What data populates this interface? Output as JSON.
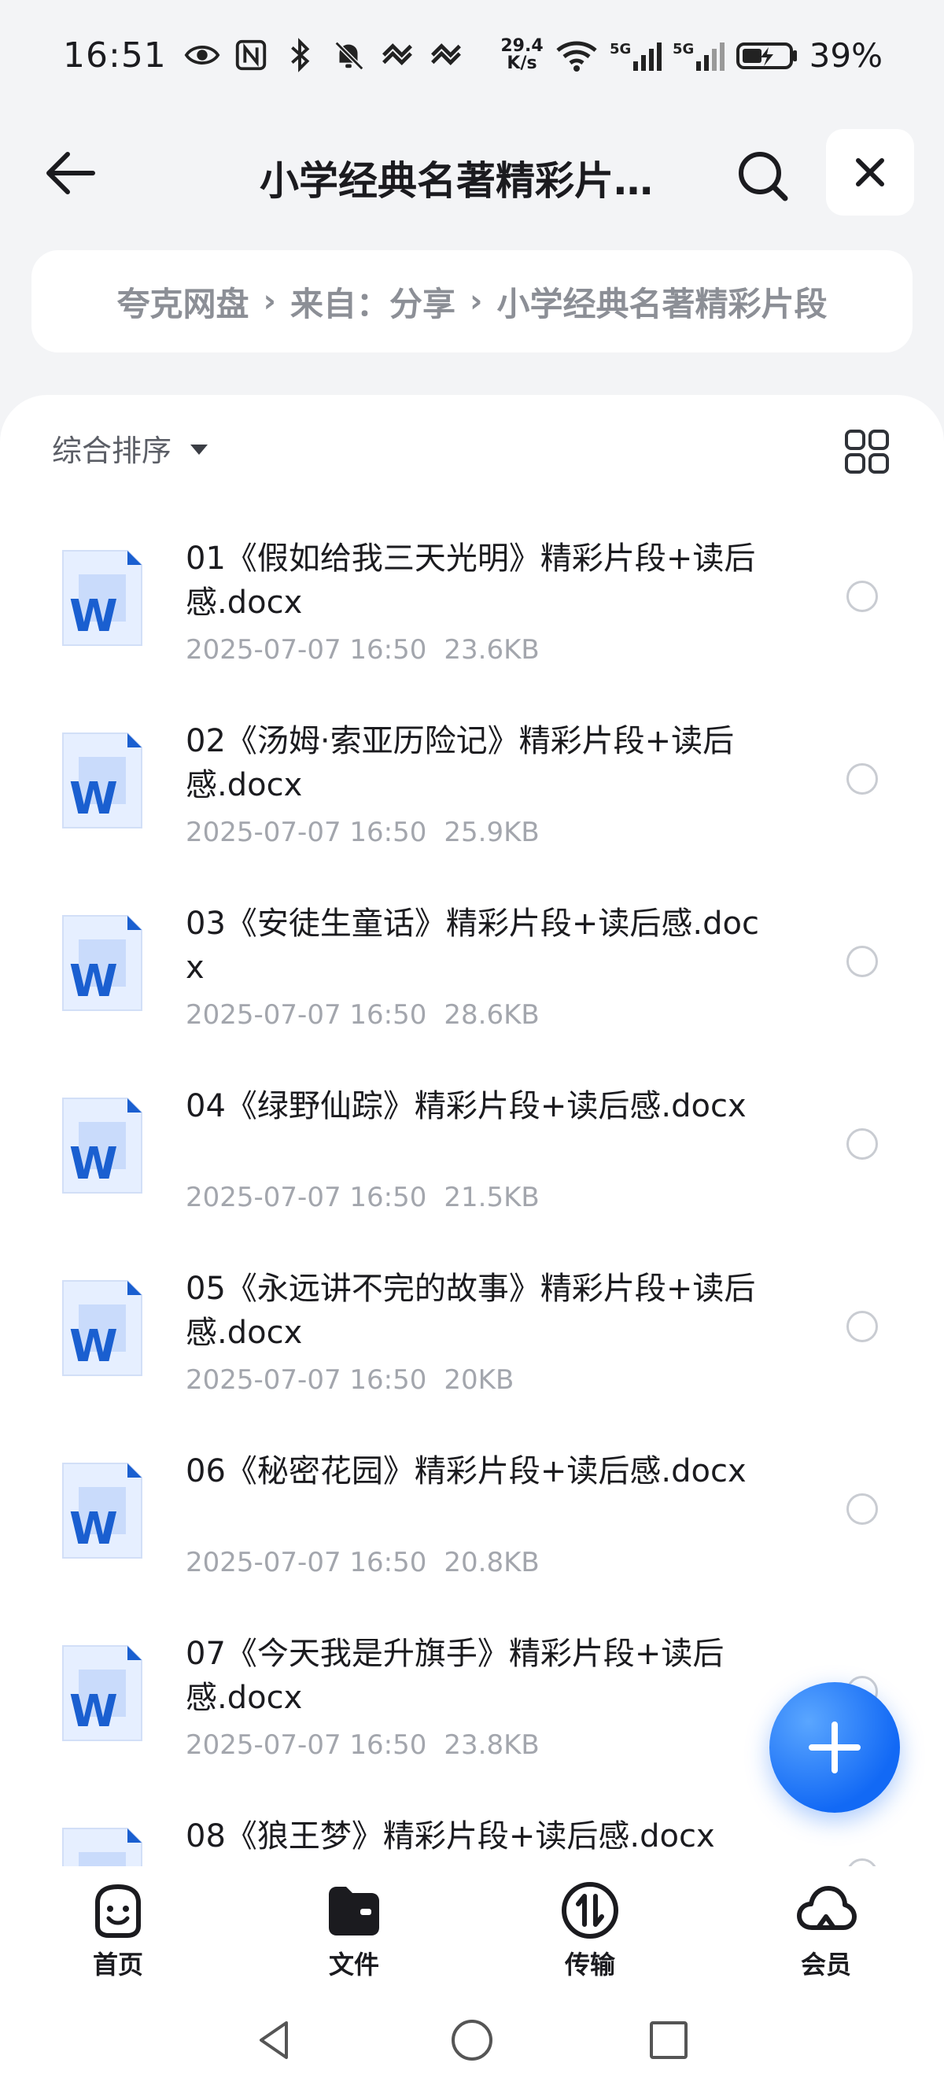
{
  "status_bar": {
    "time": "16:51",
    "net_speed_value": "29.4",
    "net_speed_unit": "K/s",
    "signal1_label": "5G",
    "signal2_label": "5G",
    "battery": "39%"
  },
  "header": {
    "title": "小学经典名著精彩片…"
  },
  "breadcrumb": {
    "items": [
      "夸克网盘",
      "来自：分享",
      "小学经典名著精彩片段"
    ]
  },
  "toolbar": {
    "sort_label": "综合排序"
  },
  "files": [
    {
      "name": "01《假如给我三天光明》精彩片段+读后感.docx",
      "date": "2025-07-07 16:50",
      "size": "23.6KB"
    },
    {
      "name": "02《汤姆·索亚历险记》精彩片段+读后感.docx",
      "date": "2025-07-07 16:50",
      "size": "25.9KB"
    },
    {
      "name": "03《安徒生童话》精彩片段+读后感.docx",
      "date": "2025-07-07 16:50",
      "size": "28.6KB"
    },
    {
      "name": "04《绿野仙踪》精彩片段+读后感.docx",
      "date": "2025-07-07 16:50",
      "size": "21.5KB"
    },
    {
      "name": "05《永远讲不完的故事》精彩片段+读后感.docx",
      "date": "2025-07-07 16:50",
      "size": "20KB"
    },
    {
      "name": "06《秘密花园》精彩片段+读后感.docx",
      "date": "2025-07-07 16:50",
      "size": "20.8KB"
    },
    {
      "name": "07《今天我是升旗手》精彩片段+读后感.docx",
      "date": "2025-07-07 16:50",
      "size": "23.8KB"
    },
    {
      "name": "08《狼王梦》精彩片段+读后感.docx",
      "date": "",
      "size": ""
    }
  ],
  "bottom_nav": [
    {
      "label": "首页",
      "icon": "home-face-icon"
    },
    {
      "label": "文件",
      "icon": "folder-icon"
    },
    {
      "label": "传输",
      "icon": "transfer-icon"
    },
    {
      "label": "会员",
      "icon": "cloud-icon"
    }
  ],
  "colors": {
    "accent": "#1269f5",
    "background": "#f3f4f6",
    "word_blue": "#1a5fd0"
  }
}
